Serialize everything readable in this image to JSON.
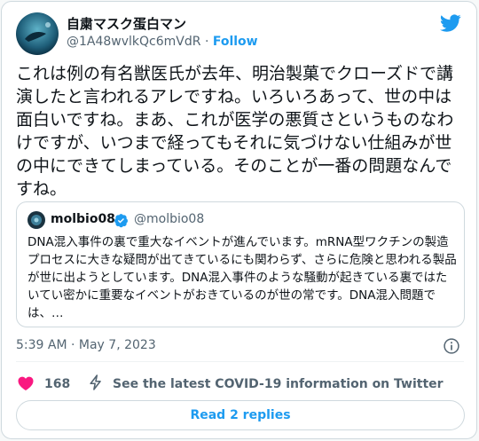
{
  "author": {
    "name": "自粛マスク蛋白マン",
    "handle": "@1A48wvlkQc6mVdR",
    "separator": "·",
    "follow_label": "Follow"
  },
  "tweet": {
    "text": "これは例の有名獣医氏が去年、明治製菓でクローズドで講演したと言われるアレですね。いろいろあって、世の中は面白いですね。まあ、これが医学の悪質さというものなわけですが、いつまで経ってもそれに気づけない仕組みが世の中にできてしまっている。そのことが一番の問題なんですね。"
  },
  "quoted_tweet": {
    "name": "molbio08",
    "handle": "@molbio08",
    "text": "DNA混入事件の裏で重大なイベントが進んでいます。mRNA型ワクチンの製造プロセスに大きな疑問が出てきているにも関わらず、さらに危険と思われる製品が世に出ようとしています。DNA混入事件のような騒動が起きている裏ではたいてい密かに重要なイベントがおきているのが世の常です。DNA混入問題では、…"
  },
  "timestamp": "5:39 AM · May 7, 2023",
  "actions": {
    "like_count": "168",
    "covid_link": "See the latest COVID-19 information on Twitter",
    "replies_label": "Read 2 replies"
  },
  "colors": {
    "accent": "#1d9bf0",
    "heart": "#f91880",
    "text_secondary": "#536471",
    "border": "#cfd9de"
  },
  "icons": [
    "twitter-bird-icon",
    "verified-badge-icon",
    "info-icon",
    "heart-icon",
    "lightning-bolt-icon"
  ]
}
